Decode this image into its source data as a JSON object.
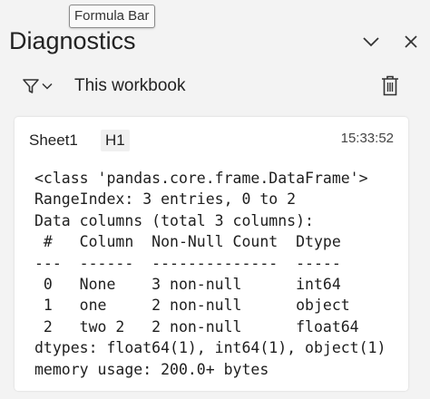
{
  "tooltip": {
    "text": "Formula Bar"
  },
  "header": {
    "title": "Diagnostics"
  },
  "toolbar": {
    "scope_label": "This workbook"
  },
  "icons": {
    "collapse": "chevron-down-icon",
    "close": "close-icon",
    "filter": "filter-icon",
    "filter_dropdown": "chevron-down-icon",
    "clear": "trash-icon"
  },
  "card": {
    "sheet": "Sheet1",
    "cell": "H1",
    "time": "15:33:52",
    "lines": [
      "<class 'pandas.core.frame.DataFrame'>",
      "RangeIndex: 3 entries, 0 to 2",
      "Data columns (total 3 columns):",
      " #   Column  Non-Null Count  Dtype",
      "---  ------  --------------  -----",
      " 0   None    3 non-null      int64",
      " 1   one     2 non-null      object",
      " 2   two 2   2 non-null      float64",
      "dtypes: float64(1), int64(1), object(1)",
      "memory usage: 200.0+ bytes"
    ]
  }
}
